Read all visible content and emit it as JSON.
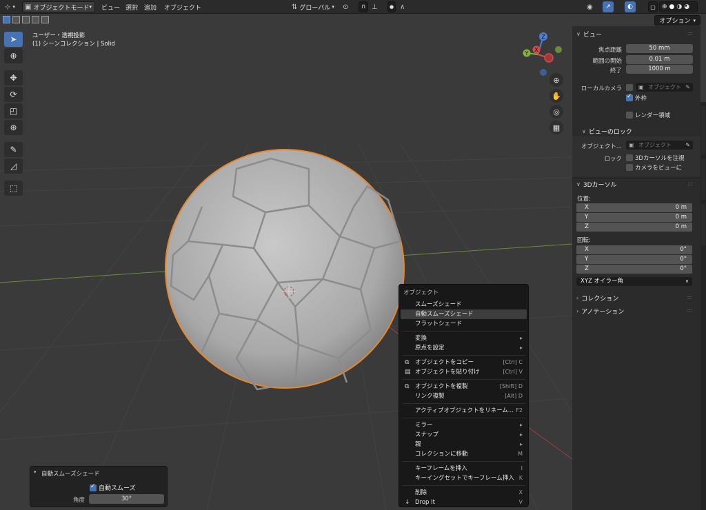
{
  "header": {
    "mode_label": "オブジェクトモード",
    "menu": [
      "ビュー",
      "選択",
      "追加",
      "オブジェクト"
    ],
    "transform_orientation": "グローバル"
  },
  "subbar": {
    "options_label": "オプション"
  },
  "viewport": {
    "view_name": "ユーザー・透視投影",
    "collection_info": "(1) シーンコレクション | Solid",
    "gizmo": {
      "x": "X",
      "y": "Y",
      "z": "Z"
    }
  },
  "redo_panel": {
    "title": "自動スムーズシェード",
    "auto_smooth_label": "自動スムーズ",
    "angle_label": "角度",
    "angle_value": "30°"
  },
  "context_menu": {
    "title": "オブジェクト",
    "items": [
      {
        "label": "スムーズシェード",
        "shortcut": "",
        "arrow": ""
      },
      {
        "label": "自動スムーズシェード",
        "shortcut": "",
        "arrow": ""
      },
      {
        "label": "フラットシェード",
        "shortcut": "",
        "arrow": ""
      },
      {
        "label": "変換",
        "shortcut": "",
        "arrow": "▸"
      },
      {
        "label": "原点を設定",
        "shortcut": "",
        "arrow": "▸"
      },
      {
        "label": "オブジェクトをコピー",
        "shortcut": "[Ctrl] C",
        "arrow": ""
      },
      {
        "label": "オブジェクトを貼り付け",
        "shortcut": "[Ctrl] V",
        "arrow": ""
      },
      {
        "label": "オブジェクトを複製",
        "shortcut": "[Shift] D",
        "arrow": ""
      },
      {
        "label": "リンク複製",
        "shortcut": "[Alt] D",
        "arrow": ""
      },
      {
        "label": "アクティブオブジェクトをリネーム...",
        "shortcut": "F2",
        "arrow": ""
      },
      {
        "label": "ミラー",
        "shortcut": "",
        "arrow": "▸"
      },
      {
        "label": "スナップ",
        "shortcut": "",
        "arrow": "▸"
      },
      {
        "label": "親",
        "shortcut": "",
        "arrow": "▸"
      },
      {
        "label": "コレクションに移動",
        "shortcut": "M",
        "arrow": ""
      },
      {
        "label": "キーフレームを挿入",
        "shortcut": "I",
        "arrow": ""
      },
      {
        "label": "キーイングセットでキーフレーム挿入",
        "shortcut": "K",
        "arrow": ""
      },
      {
        "label": "削除",
        "shortcut": "X",
        "arrow": ""
      },
      {
        "label": "Drop It",
        "shortcut": "V",
        "arrow": ""
      }
    ]
  },
  "npanel": {
    "view": {
      "title": "ビュー",
      "focal_label": "焦点距離",
      "focal_value": "50 mm",
      "clip_start_label": "範囲の開始",
      "clip_start_value": "0.01 m",
      "clip_end_label": "終了",
      "clip_end_value": "1000 m",
      "local_camera_label": "ローカルカメラ",
      "local_camera_placeholder": "オブジェクト",
      "frame_label": "外枠",
      "render_region_label": "レンダー領域"
    },
    "view_lock": {
      "title": "ビューのロック",
      "object_label": "オブジェクト...",
      "object_placeholder": "オブジェクト",
      "lock_label": "ロック",
      "cursor_label": "3Dカーソルを注視",
      "camera_label": "カメラをビューに"
    },
    "cursor": {
      "title": "3Dカーソル",
      "location_label": "位置:",
      "location": [
        {
          "axis": "X",
          "value": "0 m"
        },
        {
          "axis": "Y",
          "value": "0 m"
        },
        {
          "axis": "Z",
          "value": "0 m"
        }
      ],
      "rotation_label": "回転:",
      "rotation": [
        {
          "axis": "X",
          "value": "0°"
        },
        {
          "axis": "Y",
          "value": "0°"
        },
        {
          "axis": "Z",
          "value": "0°"
        }
      ],
      "rotation_mode": "XYZ オイラー角"
    },
    "collection_title": "コレクション",
    "annotation_title": "アノテーション"
  },
  "colors": {
    "accent": "#4772b3",
    "selection_outline": "#e8872a",
    "ball": "#b8b8b8"
  }
}
